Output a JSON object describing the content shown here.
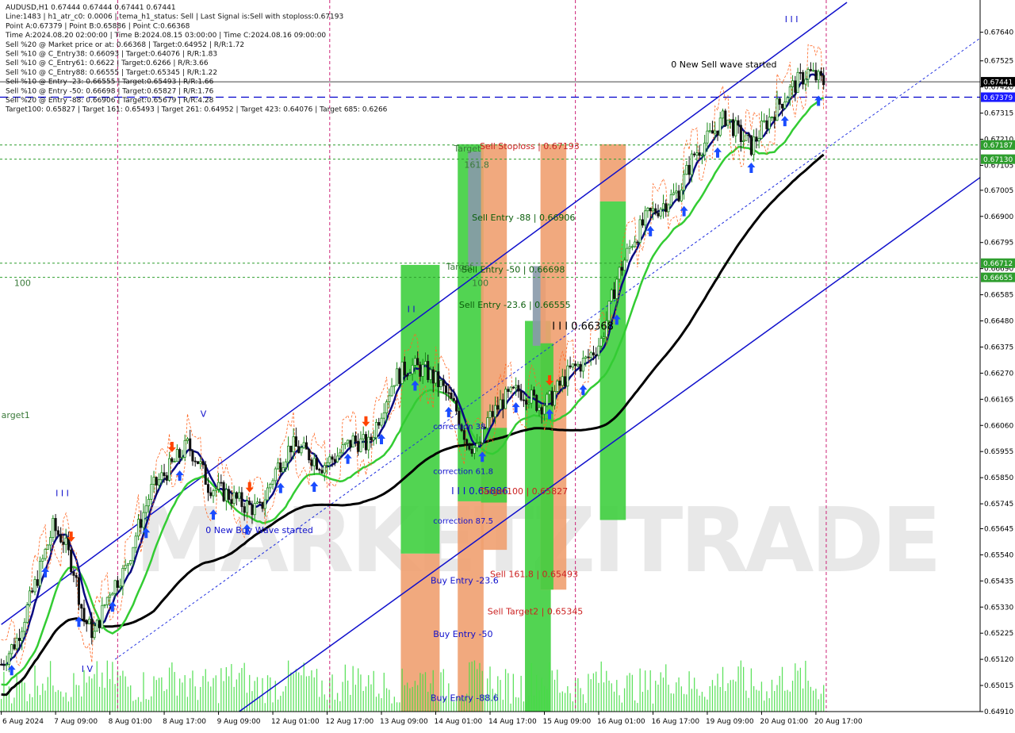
{
  "header": {
    "info_lines": [
      "AUDUSD,H1  0.67444 0.67444 0.67441 0.67441",
      "Line:1483  |  h1_atr_c0: 0.0006  |  tema_h1_status: Sell  |  Last Signal is:Sell with stoploss:0.67193",
      "Point A:0.67379  |  Point B:0.65886  |  Point C:0.66368",
      "Time A:2024.08.20 02:00:00  |  Time B:2024.08.15 03:00:00  |  Time C:2024.08.16 09:00:00",
      "Sell %20 @ Market price or at: 0.66368  |  Target:0.64952  |  R/R:1.72",
      "Sell %10 @ C_Entry38: 0.66093  |  Target:0.64076  |  R/R:1.83",
      "Sell %10 @ C_Entry61: 0.6622  |  Target:0.6266  |  R/R:3.66",
      "Sell %10 @ C_Entry88: 0.66555  |  Target:0.65345  |  R/R:1.22",
      "Sell %10 @ Entry -23: 0.66555  |  Target:0.65493  |  R/R:1.66",
      "Sell %10 @ Entry -50: 0.66698  |  Target:0.65827  |  R/R:1.76",
      "Sell %20 @ Entry -88: 0.66906  |  Target:0.65679  |  R/R:4.28",
      "Target100: 0.65827  |  Target 161: 0.65493  |  Target 261: 0.64952  |  Target 423: 0.64076  |  Target 685: 0.6266"
    ]
  },
  "chart_data": {
    "type": "candlestick",
    "symbol": "AUDUSD",
    "timeframe": "H1",
    "ylim": [
      0.6491,
      0.6776
    ],
    "y_ticks": [
      0.6764,
      0.67525,
      0.6742,
      0.67315,
      0.6721,
      0.67105,
      0.67005,
      0.669,
      0.66795,
      0.6669,
      0.66585,
      0.6648,
      0.66375,
      0.6627,
      0.66165,
      0.6606,
      0.65955,
      0.6585,
      0.65745,
      0.65645,
      0.6554,
      0.65435,
      0.6533,
      0.65225,
      0.6512,
      0.65015,
      0.6491
    ],
    "x_labels": [
      "6 Aug 2024",
      "7 Aug 09:00",
      "8 Aug 01:00",
      "8 Aug 17:00",
      "9 Aug 09:00",
      "12 Aug 01:00",
      "12 Aug 17:00",
      "13 Aug 09:00",
      "14 Aug 01:00",
      "14 Aug 17:00",
      "15 Aug 09:00",
      "16 Aug 01:00",
      "16 Aug 17:00",
      "19 Aug 09:00",
      "20 Aug 01:00",
      "20 Aug 17:00"
    ],
    "price_labels": [
      {
        "text": "0.67441",
        "value": 0.67441,
        "bg": "#000000"
      },
      {
        "text": "0.67379",
        "value": 0.67379,
        "bg": "#1a1aff"
      },
      {
        "text": "0.67187",
        "value": 0.67187,
        "bg": "#2e9e2e"
      },
      {
        "text": "0.67130",
        "value": 0.6713,
        "bg": "#2e9e2e"
      },
      {
        "text": "0.66712",
        "value": 0.66712,
        "bg": "#2e9e2e"
      },
      {
        "text": "0.66655",
        "value": 0.66655,
        "bg": "#2e9e2e"
      }
    ],
    "hlines": [
      {
        "value": 0.67441,
        "color": "#444444",
        "style": "solid"
      },
      {
        "value": 0.67379,
        "color": "#0000cc",
        "style": "dashed"
      },
      {
        "value": 0.67187,
        "color": "#2e9e2e",
        "style": "dotted"
      },
      {
        "value": 0.6713,
        "color": "#2e9e2e",
        "style": "dotted"
      },
      {
        "value": 0.66712,
        "color": "#2e9e2e",
        "style": "dotted"
      },
      {
        "value": 0.66655,
        "color": "#2e9e2e",
        "style": "dotted"
      }
    ],
    "session_separator_bars": [
      45,
      127,
      222,
      319
    ],
    "zones": [
      {
        "bar": 155,
        "width": 15,
        "y1": 0.6491,
        "y2": 0.65545,
        "color": "#f0a070"
      },
      {
        "bar": 155,
        "width": 15,
        "y1": 0.65545,
        "y2": 0.66705,
        "color": "#3fcf3f"
      },
      {
        "bar": 177,
        "width": 10,
        "y1": 0.6491,
        "y2": 0.65755,
        "color": "#f0a070"
      },
      {
        "bar": 177,
        "width": 10,
        "y1": 0.65755,
        "y2": 0.6719,
        "color": "#3fcf3f"
      },
      {
        "bar": 181,
        "width": 5,
        "y1": 0.667,
        "y2": 0.6716,
        "color": "#8899aa"
      },
      {
        "bar": 186,
        "width": 10,
        "y1": 0.6556,
        "y2": 0.6719,
        "color": "#f0a070"
      },
      {
        "bar": 186,
        "width": 10,
        "y1": 0.6575,
        "y2": 0.6605,
        "color": "#3fcf3f"
      },
      {
        "bar": 203,
        "width": 10,
        "y1": 0.6491,
        "y2": 0.6648,
        "color": "#3fcf3f"
      },
      {
        "bar": 206,
        "width": 5,
        "y1": 0.6638,
        "y2": 0.667,
        "color": "#8899aa"
      },
      {
        "bar": 209,
        "width": 10,
        "y1": 0.654,
        "y2": 0.6719,
        "color": "#f0a070"
      },
      {
        "bar": 209,
        "width": 5,
        "y1": 0.654,
        "y2": 0.6639,
        "color": "#3fcf3f"
      },
      {
        "bar": 232,
        "width": 10,
        "y1": 0.6696,
        "y2": 0.6719,
        "color": "#f0a070"
      },
      {
        "bar": 232,
        "width": 10,
        "y1": 0.6568,
        "y2": 0.6696,
        "color": "#3fcf3f"
      }
    ],
    "trend_lines": [
      {
        "from": [
          0,
          0.6526
        ],
        "to": [
          327,
          0.6776
        ],
        "color": "#1010cc",
        "width": 1.5,
        "dash": ""
      },
      {
        "from": [
          92,
          0.6491
        ],
        "to": [
          379,
          0.6706
        ],
        "color": "#1010cc",
        "width": 1.5,
        "dash": ""
      },
      {
        "from": [
          44,
          0.6512
        ],
        "to": [
          379,
          0.6762
        ],
        "color": "#2030e0",
        "width": 1,
        "dash": "3,3"
      }
    ],
    "annotations": [
      {
        "text": "0 New Sell wave started",
        "bar": 259,
        "value": 0.67498,
        "color": "#000000",
        "size": 11
      },
      {
        "text": "I I I",
        "bar": 303,
        "value": 0.6768,
        "color": "#1010cc",
        "size": 11
      },
      {
        "text": "Target",
        "bar": 175,
        "value": 0.6716,
        "color": "#3a7a3a",
        "size": 11
      },
      {
        "text": "161.8",
        "bar": 179,
        "value": 0.67095,
        "color": "#3a7a3a",
        "size": 11
      },
      {
        "text": "Sell Stoploss | 0.67193",
        "bar": 185,
        "value": 0.6717,
        "color": "#cc2222",
        "size": 11
      },
      {
        "text": "Sell Entry -88 | 0.66906",
        "bar": 182,
        "value": 0.66883,
        "color": "#0b5e0b",
        "size": 11
      },
      {
        "text": "Target",
        "bar": 172,
        "value": 0.66685,
        "color": "#3a7a3a",
        "size": 11
      },
      {
        "text": "Sell Entry -50 | 0.66698",
        "bar": 178,
        "value": 0.66675,
        "color": "#0b5e0b",
        "size": 11
      },
      {
        "text": "100",
        "bar": 182,
        "value": 0.6662,
        "color": "#3a7a3a",
        "size": 11
      },
      {
        "text": "Sell Entry -23.6 | 0.66555",
        "bar": 177,
        "value": 0.66532,
        "color": "#0b5e0b",
        "size": 11
      },
      {
        "text": "I I I  0.66368",
        "bar": 213,
        "value": 0.66445,
        "color": "#000000",
        "size": 13
      },
      {
        "text": "correction 38",
        "bar": 167,
        "value": 0.66045,
        "color": "#1010cc",
        "size": 10
      },
      {
        "text": "correction 61.8",
        "bar": 167,
        "value": 0.65865,
        "color": "#1010cc",
        "size": 10
      },
      {
        "text": "I I I  0.65886",
        "bar": 174,
        "value": 0.65783,
        "color": "#1010cc",
        "size": 12
      },
      {
        "text": "Target100 | 0.65827",
        "bar": 185,
        "value": 0.65783,
        "color": "#cc2222",
        "size": 11
      },
      {
        "text": "correction 87.5",
        "bar": 167,
        "value": 0.65665,
        "color": "#1010cc",
        "size": 10
      },
      {
        "text": "Sell 161.8 | 0.65493",
        "bar": 189,
        "value": 0.6545,
        "color": "#cc2222",
        "size": 11
      },
      {
        "text": "Buy Entry -23.6",
        "bar": 166,
        "value": 0.65425,
        "color": "#1010cc",
        "size": 11
      },
      {
        "text": "Sell Target2 | 0.65345",
        "bar": 188,
        "value": 0.653,
        "color": "#cc2222",
        "size": 11
      },
      {
        "text": "Buy Entry -50",
        "bar": 167,
        "value": 0.6521,
        "color": "#1010cc",
        "size": 11
      },
      {
        "text": "Buy Entry -88.6",
        "bar": 166,
        "value": 0.64953,
        "color": "#1010cc",
        "size": 11
      },
      {
        "text": "0 New Buy Wave started",
        "bar": 79,
        "value": 0.65628,
        "color": "#1010cc",
        "size": 11
      },
      {
        "text": "100",
        "bar": 5,
        "value": 0.6662,
        "color": "#3a7a3a",
        "size": 11
      },
      {
        "text": "arget1",
        "bar": 0,
        "value": 0.6609,
        "color": "#3a7a3a",
        "size": 11
      },
      {
        "text": "I I I",
        "bar": 21,
        "value": 0.65775,
        "color": "#1010cc",
        "size": 11
      },
      {
        "text": "I V",
        "bar": 31,
        "value": 0.6507,
        "color": "#1010cc",
        "size": 11
      },
      {
        "text": "I I",
        "bar": 157,
        "value": 0.66515,
        "color": "#1010cc",
        "size": 11
      },
      {
        "text": "V",
        "bar": 77,
        "value": 0.66095,
        "color": "#1010cc",
        "size": 11
      }
    ],
    "watermark": "MARKETZITRADE"
  },
  "colors": {
    "bull_candle": "#1a8a1a",
    "bear_candle": "#111111",
    "volume": "#44dd44",
    "ema_slow": "#000000",
    "ema_mid": "#33cc33",
    "tema": "#0a0a80",
    "stop_line": "#ff6622",
    "up_arrow": "#1a4cff",
    "down_arrow": "#ff4400",
    "separator": "#cc2277"
  }
}
